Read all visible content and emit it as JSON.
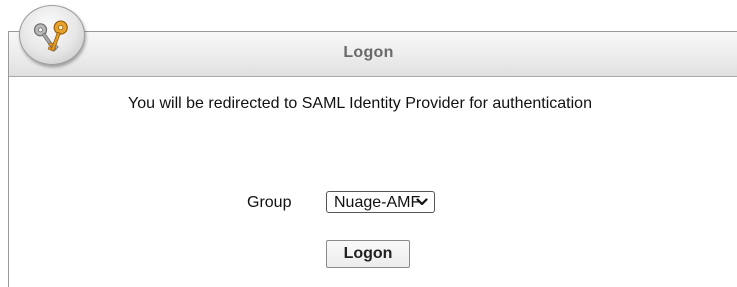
{
  "panel": {
    "title": "Logon",
    "icon": "keys-icon"
  },
  "message": "You will be redirected to SAML Identity Provider for authentication",
  "group": {
    "label": "Group",
    "selected": "Nuage-AMF"
  },
  "logon_button": {
    "label": "Logon"
  },
  "colors": {
    "title_text": "#6a6a6a",
    "border": "#9a9a9a",
    "text": "#111111"
  }
}
